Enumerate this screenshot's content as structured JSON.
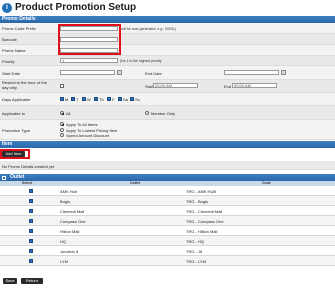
{
  "page": {
    "title": "Product Promotion Setup",
    "header_icon": "info-circle-icon"
  },
  "promo_details": {
    "section_title": "Promo Details",
    "promo_code_prefix": {
      "label": "Promo Code Prefix",
      "value": "",
      "hint": "(will be auto generated, e.g.: 00001)"
    },
    "barcode": {
      "label": "Barcode",
      "value": ""
    },
    "promo_name": {
      "label": "Promo Name",
      "value": ""
    },
    "priority": {
      "label": "Priority",
      "value": "1",
      "hint": "(No 1 is the highest priority"
    },
    "start_date": {
      "label": "Start Date",
      "value": ""
    },
    "end_date": {
      "label": "End Date",
      "value": ""
    },
    "restrict_hour": {
      "label": "Restrict to the hour of the day only",
      "checked": false,
      "start_label": "Start",
      "start_value": "00:00 AM",
      "end_label": "End",
      "end_value": "00:00 AM"
    },
    "days_applicable": {
      "label": "Days Applicable",
      "days": [
        {
          "name": "M",
          "checked": true
        },
        {
          "name": "T",
          "checked": true
        },
        {
          "name": "W",
          "checked": true
        },
        {
          "name": "Th",
          "checked": true
        },
        {
          "name": "F",
          "checked": true
        },
        {
          "name": "Sa",
          "checked": true
        },
        {
          "name": "Su",
          "checked": true
        }
      ]
    },
    "applicable_to": {
      "label": "Applicable to",
      "options": [
        {
          "label": "All",
          "selected": true
        },
        {
          "label": "Member Only",
          "selected": false
        }
      ]
    },
    "promotion_type": {
      "label": "Promotion Type",
      "options": [
        {
          "label": "Apply To All Items",
          "selected": true
        },
        {
          "label": "Apply To Lowest Pricing Item",
          "selected": false
        },
        {
          "label": "Spend Amount Discount",
          "selected": false
        }
      ]
    }
  },
  "item": {
    "section_title": "Item",
    "add_button": "Add Item",
    "empty_text": "No Promo Details created yet"
  },
  "outlet": {
    "section_title": "Outlet",
    "columns": [
      "Select",
      "Outlet",
      "Code"
    ],
    "rows": [
      {
        "checked": true,
        "name": "AMK Hub",
        "code": "TRG - AMK HUB"
      },
      {
        "checked": true,
        "name": "Bugis",
        "code": "TRG - Bugis"
      },
      {
        "checked": true,
        "name": "Clementi Mall",
        "code": "TRG - Clementi Mall"
      },
      {
        "checked": true,
        "name": "Compass One",
        "code": "TRG - Compass One"
      },
      {
        "checked": true,
        "name": "Hillion Mall",
        "code": "TRG - Hillion Mall"
      },
      {
        "checked": true,
        "name": "HQ",
        "code": "TRG - HQ"
      },
      {
        "checked": true,
        "name": "Junction 8",
        "code": "TRG - J8"
      },
      {
        "checked": true,
        "name": "LYM",
        "code": "TRG - LYM"
      }
    ]
  },
  "footer": {
    "save": "Save",
    "return": "Return"
  },
  "colors": {
    "section_header": "#2a67a8",
    "highlight": "#e0101a",
    "checkbox_checked": "#2d6db5"
  }
}
